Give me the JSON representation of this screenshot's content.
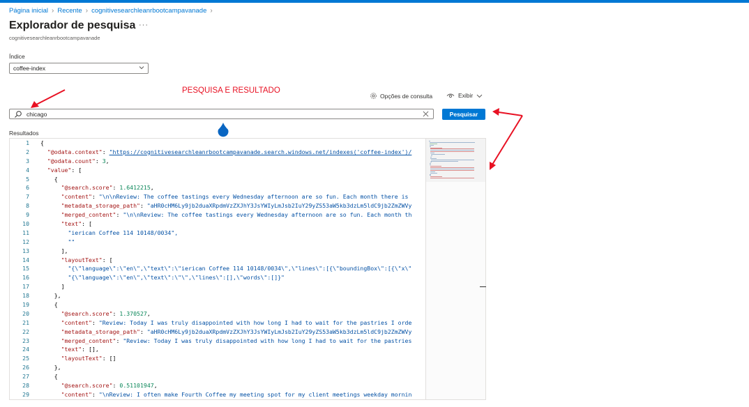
{
  "breadcrumb": {
    "items": [
      "Página inicial",
      "Recente",
      "cognitivesearchleanrbootcampavanade"
    ]
  },
  "header": {
    "title": "Explorador de pesquisa",
    "more_label": "···",
    "subtitle": "cognitivesearchleanrbootcampavanade"
  },
  "index": {
    "label": "Índice",
    "selected": "coffee-index"
  },
  "annotation": {
    "title": "PESQUISA E RESULTADO",
    "color": "#e81123"
  },
  "toolbar": {
    "query_options_label": "Opções de consulta",
    "view_label": "Exibir"
  },
  "search": {
    "value": "chicago",
    "button_label": "Pesquisar"
  },
  "results": {
    "label": "Resultados",
    "lines": [
      {
        "n": "1",
        "text": "{"
      },
      {
        "n": "2",
        "text": "  \"@odata.context\": \"https://cognitivesearchleanrbootcampavanade.search.windows.net/indexes('coffee-index')/"
      },
      {
        "n": "3",
        "text": "  \"@odata.count\": 3,"
      },
      {
        "n": "4",
        "text": "  \"value\": ["
      },
      {
        "n": "5",
        "text": "    {"
      },
      {
        "n": "6",
        "text": "      \"@search.score\": 1.6412215,"
      },
      {
        "n": "7",
        "text": "      \"content\": \"\\n\\nReview: The coffee tastings every Wednesday afternoon are so fun. Each month there is"
      },
      {
        "n": "8",
        "text": "      \"metadata_storage_path\": \"aHR0cHM6Ly9jb2duaXRpdmVzZXJhY3JsYWIyLmJsb2IuY29yZS53aW5kb3dzLm5ldC9jb2ZmZWVy"
      },
      {
        "n": "9",
        "text": "      \"merged_content\": \"\\n\\nReview: The coffee tastings every Wednesday afternoon are so fun. Each month th"
      },
      {
        "n": "10",
        "text": "      \"text\": ["
      },
      {
        "n": "11",
        "text": "        \"ierican Coffee 114 10148/0034\","
      },
      {
        "n": "12",
        "text": "        \"\""
      },
      {
        "n": "13",
        "text": "      ],"
      },
      {
        "n": "14",
        "text": "      \"layoutText\": ["
      },
      {
        "n": "15",
        "text": "        \"{\\\"language\\\":\\\"en\\\",\\\"text\\\":\\\"ierican Coffee 114 10148/0034\\\",\\\"lines\\\":[{\\\"boundingBox\\\":[{\\\"x\\\""
      },
      {
        "n": "16",
        "text": "        \"{\\\"language\\\":\\\"en\\\",\\\"text\\\":\\\"\\\",\\\"lines\\\":[],\\\"words\\\":[]}\""
      },
      {
        "n": "17",
        "text": "      ]"
      },
      {
        "n": "18",
        "text": "    },"
      },
      {
        "n": "19",
        "text": "    {"
      },
      {
        "n": "20",
        "text": "      \"@search.score\": 1.370527,"
      },
      {
        "n": "21",
        "text": "      \"content\": \"Review: Today I was truly disappointed with how long I had to wait for the pastries I orde"
      },
      {
        "n": "22",
        "text": "      \"metadata_storage_path\": \"aHR0cHM6Ly9jb2duaXRpdmVzZXJhY3JsYWIyLmJsb2IuY29yZS53aW5kb3dzLm5ldC9jb2ZmZWVy"
      },
      {
        "n": "23",
        "text": "      \"merged_content\": \"Review: Today I was truly disappointed with how long I had to wait for the pastries"
      },
      {
        "n": "24",
        "text": "      \"text\": [],"
      },
      {
        "n": "25",
        "text": "      \"layoutText\": []"
      },
      {
        "n": "26",
        "text": "    },"
      },
      {
        "n": "27",
        "text": "    {"
      },
      {
        "n": "28",
        "text": "      \"@search.score\": 0.51101947,"
      },
      {
        "n": "29",
        "text": "      \"content\": \"\\nReview: I often make Fourth Coffee my meeting spot for my client meetings weekday mornin"
      }
    ]
  },
  "colors": {
    "accent": "#0078d4",
    "json_key": "#a31515",
    "json_string": "#0451a5",
    "json_number": "#098658",
    "line_number": "#237893"
  },
  "icons": {
    "query_options": "gear-icon",
    "view": "eye-icon",
    "search": "search-icon",
    "clear": "close-icon",
    "select": "chevron-down-icon"
  }
}
